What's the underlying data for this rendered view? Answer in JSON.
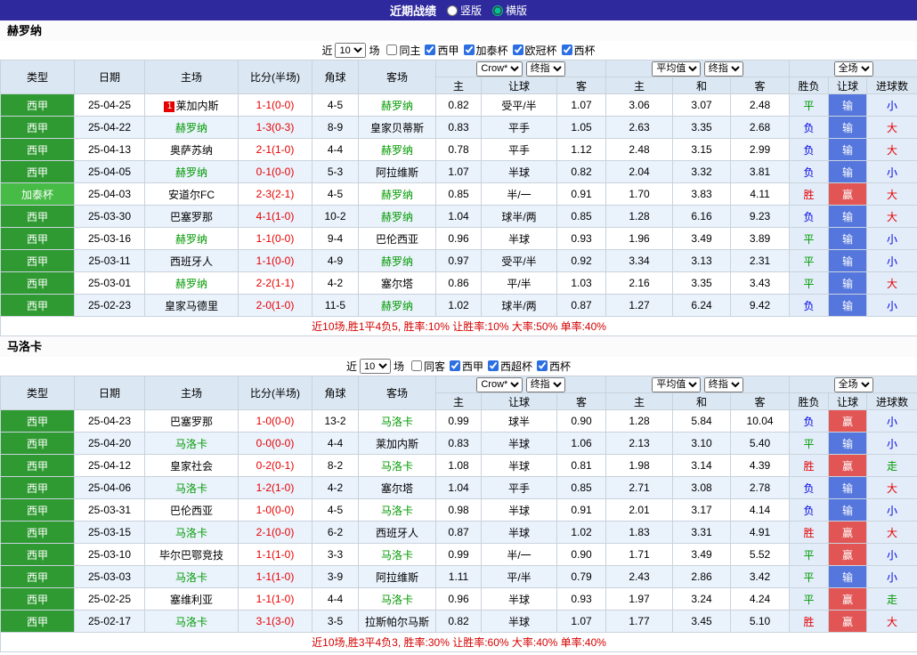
{
  "topbar": {
    "title": "近期战绩",
    "radios": [
      {
        "label": "竖版",
        "checked": false
      },
      {
        "label": "横版",
        "checked": true
      }
    ]
  },
  "colors": {
    "topbar_bg": "#2e2a9d",
    "radio_accent": "#00c29a",
    "header_bg": "#dbe7f3",
    "row_alt_bg": "#eaf2fc",
    "right_cols_bg": "#e2edf9",
    "league_green": "#2f9a32",
    "cup_green": "#46bb46",
    "focus_team": "#009900",
    "score_red": "#e60000",
    "win_red": "#e60000",
    "draw_green": "#009900",
    "lose_blue": "#0000e6",
    "handicap_win_bg": "#e25555",
    "handicap_lose_bg": "#5577dd"
  },
  "sections": [
    {
      "team": "赫罗纳",
      "filter": {
        "near_label": "近",
        "count": "10",
        "games_label": "场",
        "checkboxes": [
          {
            "label": "同主",
            "checked": false
          },
          {
            "label": "西甲",
            "checked": true
          },
          {
            "label": "加泰杯",
            "checked": true
          },
          {
            "label": "欧冠杯",
            "checked": true
          },
          {
            "label": "西杯",
            "checked": true
          }
        ]
      },
      "header": {
        "type": "类型",
        "date": "日期",
        "home": "主场",
        "score": "比分(半场)",
        "corner": "角球",
        "away": "客场",
        "odds_group": [
          "Crow*",
          "终指"
        ],
        "avg_group": [
          "平均值",
          "终指"
        ],
        "full_group": [
          "全场"
        ],
        "sub": [
          "主",
          "让球",
          "客",
          "主",
          "和",
          "客",
          "胜负",
          "让球",
          "进球数"
        ]
      },
      "rows": [
        {
          "type": "西甲",
          "cup": false,
          "date": "25-04-25",
          "home": "莱加内斯",
          "badge": "1",
          "home_focus": false,
          "score": "1-1(0-0)",
          "corner": "4-5",
          "away": "赫罗纳",
          "away_focus": true,
          "odds": [
            "0.82",
            "受平/半",
            "1.07"
          ],
          "avg": [
            "3.06",
            "3.07",
            "2.48"
          ],
          "result": "平",
          "handicap": "输",
          "goals": "小"
        },
        {
          "type": "西甲",
          "cup": false,
          "date": "25-04-22",
          "home": "赫罗纳",
          "home_focus": true,
          "score": "1-3(0-3)",
          "corner": "8-9",
          "away": "皇家贝蒂斯",
          "away_focus": false,
          "odds": [
            "0.83",
            "平手",
            "1.05"
          ],
          "avg": [
            "2.63",
            "3.35",
            "2.68"
          ],
          "result": "负",
          "handicap": "输",
          "goals": "大"
        },
        {
          "type": "西甲",
          "cup": false,
          "date": "25-04-13",
          "home": "奥萨苏纳",
          "home_focus": false,
          "score": "2-1(1-0)",
          "corner": "4-4",
          "away": "赫罗纳",
          "away_focus": true,
          "odds": [
            "0.78",
            "平手",
            "1.12"
          ],
          "avg": [
            "2.48",
            "3.15",
            "2.99"
          ],
          "result": "负",
          "handicap": "输",
          "goals": "大"
        },
        {
          "type": "西甲",
          "cup": false,
          "date": "25-04-05",
          "home": "赫罗纳",
          "home_focus": true,
          "score": "0-1(0-0)",
          "corner": "5-3",
          "away": "阿拉维斯",
          "away_focus": false,
          "odds": [
            "1.07",
            "半球",
            "0.82"
          ],
          "avg": [
            "2.04",
            "3.32",
            "3.81"
          ],
          "result": "负",
          "handicap": "输",
          "goals": "小"
        },
        {
          "type": "加泰杯",
          "cup": true,
          "date": "25-04-03",
          "home": "安道尔FC",
          "home_focus": false,
          "score": "2-3(2-1)",
          "corner": "4-5",
          "away": "赫罗纳",
          "away_focus": true,
          "odds": [
            "0.85",
            "半/一",
            "0.91"
          ],
          "avg": [
            "1.70",
            "3.83",
            "4.11"
          ],
          "result": "胜",
          "handicap": "赢",
          "goals": "大"
        },
        {
          "type": "西甲",
          "cup": false,
          "date": "25-03-30",
          "home": "巴塞罗那",
          "home_focus": false,
          "score": "4-1(1-0)",
          "corner": "10-2",
          "away": "赫罗纳",
          "away_focus": true,
          "odds": [
            "1.04",
            "球半/两",
            "0.85"
          ],
          "avg": [
            "1.28",
            "6.16",
            "9.23"
          ],
          "result": "负",
          "handicap": "输",
          "goals": "大"
        },
        {
          "type": "西甲",
          "cup": false,
          "date": "25-03-16",
          "home": "赫罗纳",
          "home_focus": true,
          "score": "1-1(0-0)",
          "corner": "9-4",
          "away": "巴伦西亚",
          "away_focus": false,
          "odds": [
            "0.96",
            "半球",
            "0.93"
          ],
          "avg": [
            "1.96",
            "3.49",
            "3.89"
          ],
          "result": "平",
          "handicap": "输",
          "goals": "小"
        },
        {
          "type": "西甲",
          "cup": false,
          "date": "25-03-11",
          "home": "西班牙人",
          "home_focus": false,
          "score": "1-1(0-0)",
          "corner": "4-9",
          "away": "赫罗纳",
          "away_focus": true,
          "odds": [
            "0.97",
            "受平/半",
            "0.92"
          ],
          "avg": [
            "3.34",
            "3.13",
            "2.31"
          ],
          "result": "平",
          "handicap": "输",
          "goals": "小"
        },
        {
          "type": "西甲",
          "cup": false,
          "date": "25-03-01",
          "home": "赫罗纳",
          "home_focus": true,
          "score": "2-2(1-1)",
          "corner": "4-2",
          "away": "塞尔塔",
          "away_focus": false,
          "odds": [
            "0.86",
            "平/半",
            "1.03"
          ],
          "avg": [
            "2.16",
            "3.35",
            "3.43"
          ],
          "result": "平",
          "handicap": "输",
          "goals": "大"
        },
        {
          "type": "西甲",
          "cup": false,
          "date": "25-02-23",
          "home": "皇家马德里",
          "home_focus": false,
          "score": "2-0(1-0)",
          "corner": "11-5",
          "away": "赫罗纳",
          "away_focus": true,
          "odds": [
            "1.02",
            "球半/两",
            "0.87"
          ],
          "avg": [
            "1.27",
            "6.24",
            "9.42"
          ],
          "result": "负",
          "handicap": "输",
          "goals": "小"
        }
      ],
      "summary": "近10场,胜1平4负5, 胜率:10% 让胜率:10% 大率:50% 单率:40%"
    },
    {
      "team": "马洛卡",
      "filter": {
        "near_label": "近",
        "count": "10",
        "games_label": "场",
        "checkboxes": [
          {
            "label": "同客",
            "checked": false
          },
          {
            "label": "西甲",
            "checked": true
          },
          {
            "label": "西超杯",
            "checked": true
          },
          {
            "label": "西杯",
            "checked": true
          }
        ]
      },
      "header": {
        "type": "类型",
        "date": "日期",
        "home": "主场",
        "score": "比分(半场)",
        "corner": "角球",
        "away": "客场",
        "odds_group": [
          "Crow*",
          "终指"
        ],
        "avg_group": [
          "平均值",
          "终指"
        ],
        "full_group": [
          "全场"
        ],
        "sub": [
          "主",
          "让球",
          "客",
          "主",
          "和",
          "客",
          "胜负",
          "让球",
          "进球数"
        ]
      },
      "rows": [
        {
          "type": "西甲",
          "cup": false,
          "date": "25-04-23",
          "home": "巴塞罗那",
          "home_focus": false,
          "score": "1-0(0-0)",
          "corner": "13-2",
          "away": "马洛卡",
          "away_focus": true,
          "odds": [
            "0.99",
            "球半",
            "0.90"
          ],
          "avg": [
            "1.28",
            "5.84",
            "10.04"
          ],
          "result": "负",
          "handicap": "赢",
          "goals": "小"
        },
        {
          "type": "西甲",
          "cup": false,
          "date": "25-04-20",
          "home": "马洛卡",
          "home_focus": true,
          "score": "0-0(0-0)",
          "corner": "4-4",
          "away": "莱加内斯",
          "away_focus": false,
          "odds": [
            "0.83",
            "半球",
            "1.06"
          ],
          "avg": [
            "2.13",
            "3.10",
            "5.40"
          ],
          "result": "平",
          "handicap": "输",
          "goals": "小"
        },
        {
          "type": "西甲",
          "cup": false,
          "date": "25-04-12",
          "home": "皇家社会",
          "home_focus": false,
          "score": "0-2(0-1)",
          "corner": "8-2",
          "away": "马洛卡",
          "away_focus": true,
          "odds": [
            "1.08",
            "半球",
            "0.81"
          ],
          "avg": [
            "1.98",
            "3.14",
            "4.39"
          ],
          "result": "胜",
          "handicap": "赢",
          "goals": "走"
        },
        {
          "type": "西甲",
          "cup": false,
          "date": "25-04-06",
          "home": "马洛卡",
          "home_focus": true,
          "score": "1-2(1-0)",
          "corner": "4-2",
          "away": "塞尔塔",
          "away_focus": false,
          "odds": [
            "1.04",
            "平手",
            "0.85"
          ],
          "avg": [
            "2.71",
            "3.08",
            "2.78"
          ],
          "result": "负",
          "handicap": "输",
          "goals": "大"
        },
        {
          "type": "西甲",
          "cup": false,
          "date": "25-03-31",
          "home": "巴伦西亚",
          "home_focus": false,
          "score": "1-0(0-0)",
          "corner": "4-5",
          "away": "马洛卡",
          "away_focus": true,
          "odds": [
            "0.98",
            "半球",
            "0.91"
          ],
          "avg": [
            "2.01",
            "3.17",
            "4.14"
          ],
          "result": "负",
          "handicap": "输",
          "goals": "小"
        },
        {
          "type": "西甲",
          "cup": false,
          "date": "25-03-15",
          "home": "马洛卡",
          "home_focus": true,
          "score": "2-1(0-0)",
          "corner": "6-2",
          "away": "西班牙人",
          "away_focus": false,
          "odds": [
            "0.87",
            "半球",
            "1.02"
          ],
          "avg": [
            "1.83",
            "3.31",
            "4.91"
          ],
          "result": "胜",
          "handicap": "赢",
          "goals": "大"
        },
        {
          "type": "西甲",
          "cup": false,
          "date": "25-03-10",
          "home": "毕尔巴鄂竞技",
          "home_focus": false,
          "score": "1-1(1-0)",
          "corner": "3-3",
          "away": "马洛卡",
          "away_focus": true,
          "odds": [
            "0.99",
            "半/一",
            "0.90"
          ],
          "avg": [
            "1.71",
            "3.49",
            "5.52"
          ],
          "result": "平",
          "handicap": "赢",
          "goals": "小"
        },
        {
          "type": "西甲",
          "cup": false,
          "date": "25-03-03",
          "home": "马洛卡",
          "home_focus": true,
          "score": "1-1(1-0)",
          "corner": "3-9",
          "away": "阿拉维斯",
          "away_focus": false,
          "odds": [
            "1.11",
            "平/半",
            "0.79"
          ],
          "avg": [
            "2.43",
            "2.86",
            "3.42"
          ],
          "result": "平",
          "handicap": "输",
          "goals": "小"
        },
        {
          "type": "西甲",
          "cup": false,
          "date": "25-02-25",
          "home": "塞维利亚",
          "home_focus": false,
          "score": "1-1(1-0)",
          "corner": "4-4",
          "away": "马洛卡",
          "away_focus": true,
          "odds": [
            "0.96",
            "半球",
            "0.93"
          ],
          "avg": [
            "1.97",
            "3.24",
            "4.24"
          ],
          "result": "平",
          "handicap": "赢",
          "goals": "走"
        },
        {
          "type": "西甲",
          "cup": false,
          "date": "25-02-17",
          "home": "马洛卡",
          "home_focus": true,
          "score": "3-1(3-0)",
          "corner": "3-5",
          "away": "拉斯帕尔马斯",
          "away_focus": false,
          "odds": [
            "0.82",
            "半球",
            "1.07"
          ],
          "avg": [
            "1.77",
            "3.45",
            "5.10"
          ],
          "result": "胜",
          "handicap": "赢",
          "goals": "大"
        }
      ],
      "summary": "近10场,胜3平4负3, 胜率:30% 让胜率:60% 大率:40% 单率:40%"
    }
  ]
}
